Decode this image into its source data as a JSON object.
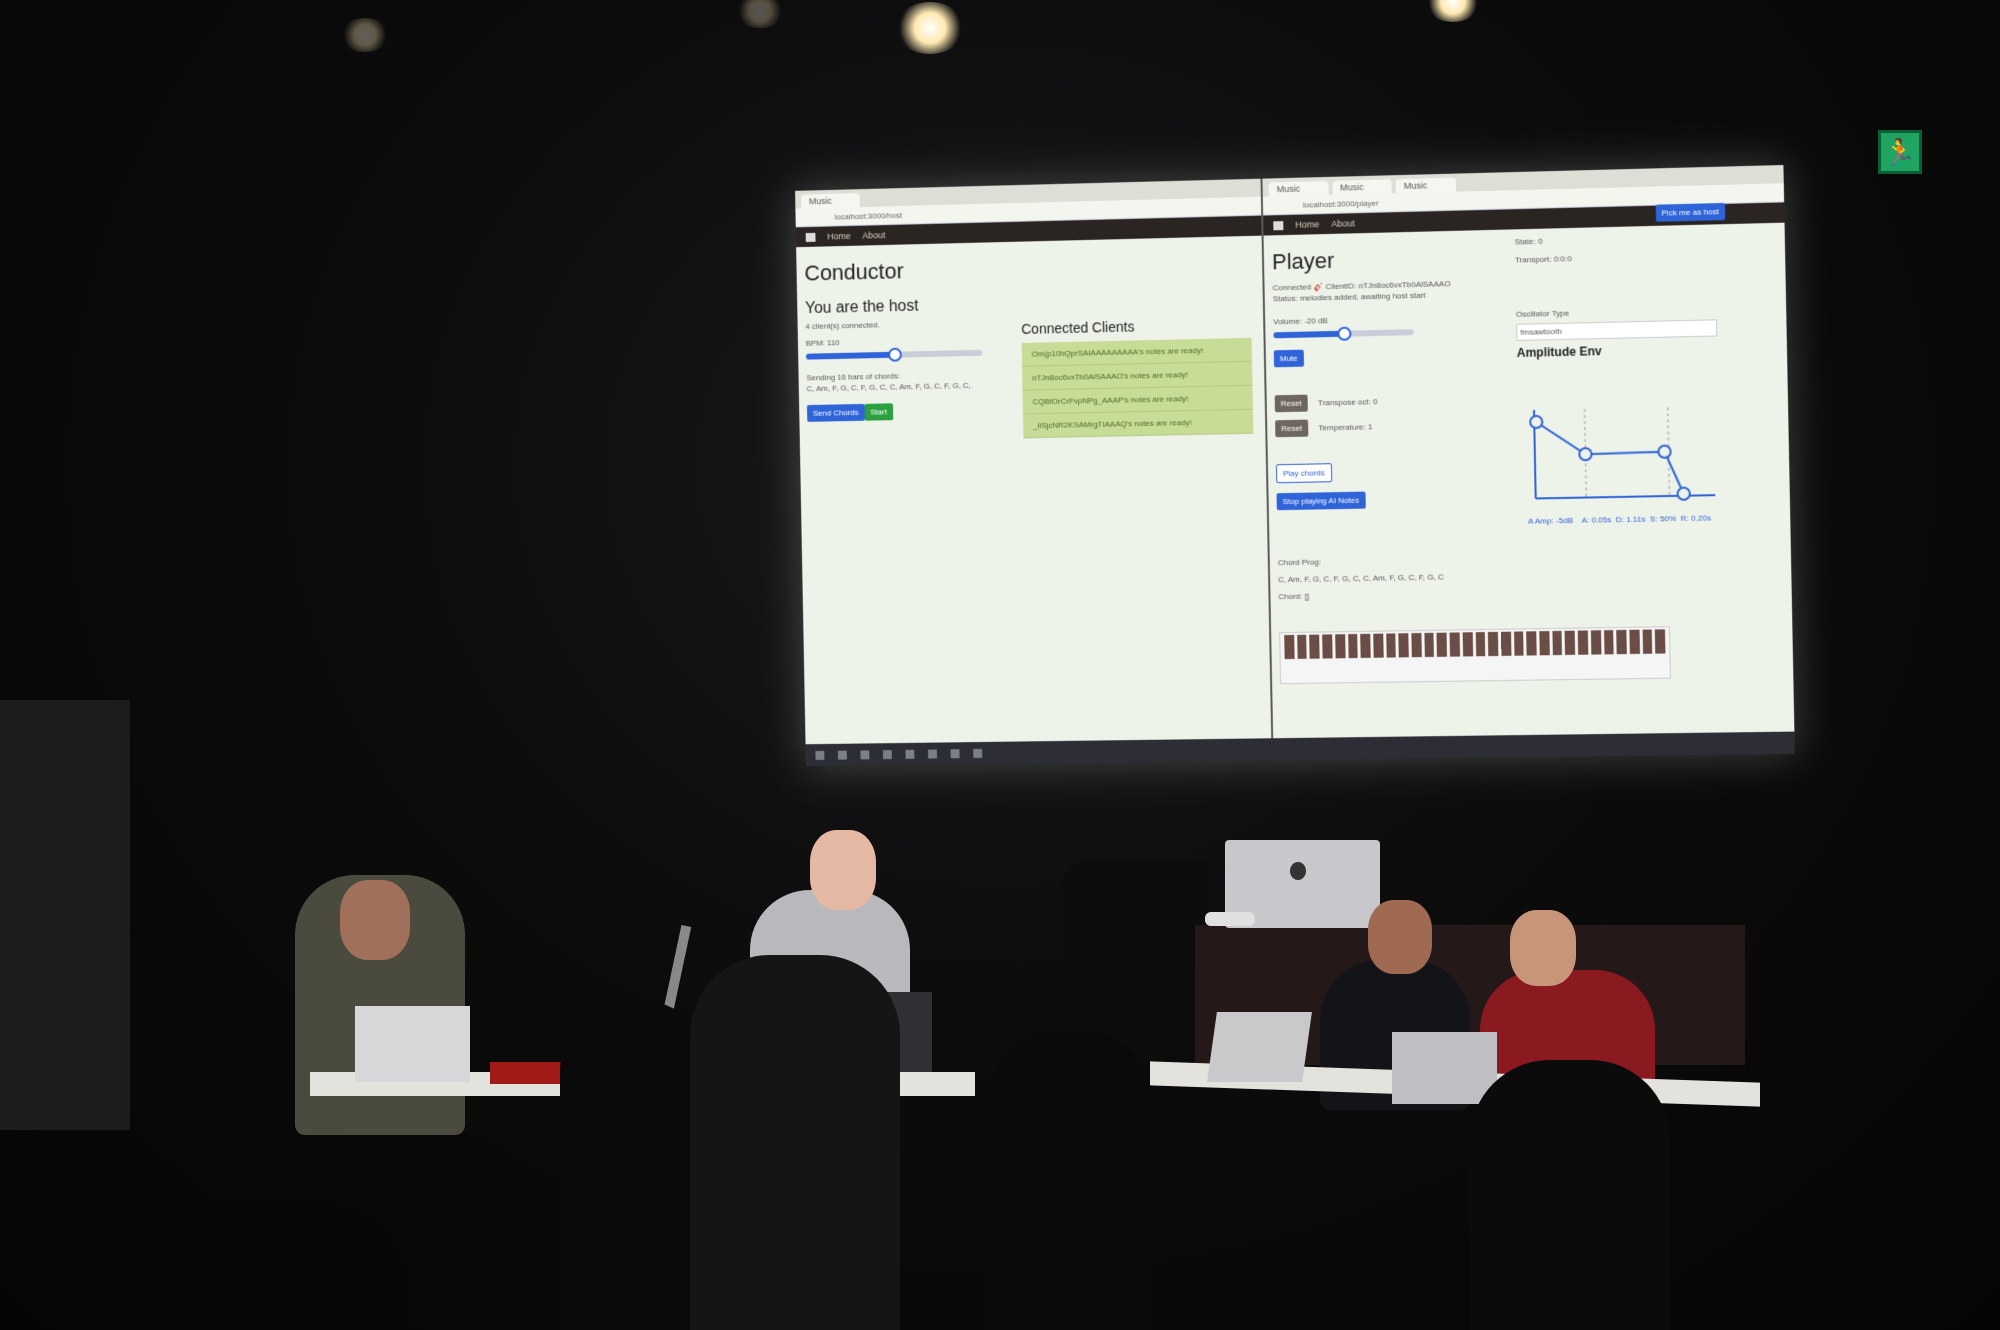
{
  "conductor": {
    "tab_title": "Music",
    "url": "localhost:3000/host",
    "nav_home": "Home",
    "nav_about": "About",
    "title": "Conductor",
    "host_heading": "You are the host",
    "clients_connected": "4 client(s) connected.",
    "bpm_label": "BPM: 110",
    "bpm_level": 0.5,
    "sending_label": "Sending 16 bars of chords:",
    "chords": "C, Am, F, G, C, F, G, C, C, Am, F, G, C, F, G, C,",
    "send_button": "Send Chords",
    "start_button": "Start",
    "clients_heading": "Connected Clients",
    "clients": [
      "Om(p10hQprSAIAAAAAAAAA's notes are ready!",
      "nTJn8oc6vxTb0AlSAAAO's notes are ready!",
      "CQBfOrCrFvpNPg_AAAP's notes are ready!",
      "_IiSjcNR2KSAMrgTIAAAQ's notes are ready!"
    ]
  },
  "player": {
    "tabs": [
      "Music",
      "Music",
      "Music"
    ],
    "url": "localhost:3000/player",
    "nav_home": "Home",
    "nav_about": "About",
    "pick_host_button": "Pick me as host",
    "title": "Player",
    "client_id": "Connected 🎸 ClientID: nTJn8oc6vxTb0AlSAAAO",
    "status": "Status: melodies added, awaiting host start",
    "state": "State: 0",
    "transport": "Transport: 0:0:0",
    "volume_label": "Volume: -20 dB",
    "volume_level": 0.5,
    "mute_button": "Mute",
    "oscillator_label": "Oscillator Type",
    "oscillator_value": "fmsawtooth",
    "amp_env_heading": "Amplitude Env",
    "reset_label": "Reset",
    "transpose_label": "Transpose oct: 0",
    "temperature_label": "Temperature: 1",
    "play_chords_button": "Play chords",
    "stop_ai_button": "Stop playing AI Notes",
    "env_labels": "A Amp: -5dB    A: 0.05s  D: 1.11s  S: 50%  R: 0.20s",
    "chord_prog_label": "Chord Prog:",
    "chord_prog": "C, Am, F, G, C, F, G, C, C, Am, F, G, C, F, G, C",
    "chord_label": "Chord: []"
  },
  "colors": {
    "primary": "#2f63d8",
    "success": "#2aa040",
    "client_bg": "#c7dc96",
    "exit_sign": "#1fa463"
  },
  "icons": [
    "exit-sign-icon",
    "apple-logo-icon"
  ]
}
